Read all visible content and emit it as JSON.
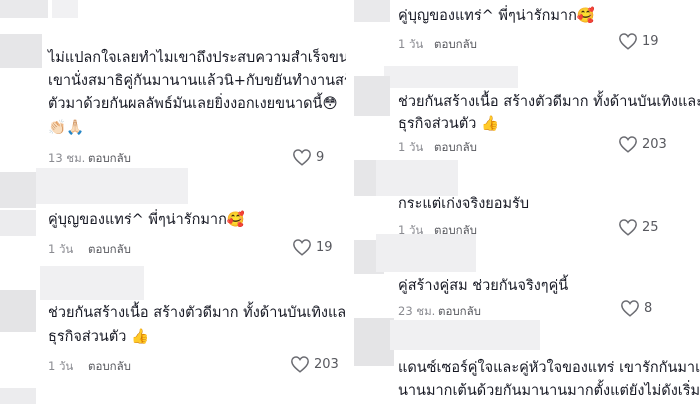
{
  "left": {
    "comments": [
      {
        "lines": [
          "ไม่แปลกใจเลยทำไมเขาถึงประสบความสำเร็จขนาดนี้",
          "เขานั่งสมาธิคู่กันมานานแล้วนิ+กับขยันทำงานสร้าง",
          "ตัวมาด้วยกันผลลัพธ์มันเลยยิ่งงอกเงยขนาดนี้😳",
          "👏🏻🙏🏻"
        ],
        "time": "13 ชม.",
        "reply": "ตอบกลับ",
        "likes": "9"
      },
      {
        "lines": [
          "คู่บุญของแทร่^ พี่ๆน่ารักมาก🥰"
        ],
        "time": "1 วัน",
        "reply": "ตอบกลับ",
        "likes": "19"
      },
      {
        "lines": [
          "ช่วยกันสร้างเนื้อ สร้างตัวดีมาก ทั้งด้านบันเทิงและ",
          "ธุรกิจส่วนตัว 👍"
        ],
        "time": "1 วัน",
        "reply": "ตอบกลับ",
        "likes": "203"
      }
    ]
  },
  "right": {
    "comments": [
      {
        "lines": [
          "คู่บุญของแทร่^ พี่ๆน่ารักมาก🥰"
        ],
        "time": "1 วัน",
        "reply": "ตอบกลับ",
        "likes": "19"
      },
      {
        "lines": [
          "ช่วยกันสร้างเนื้อ สร้างตัวดีมาก ทั้งด้านบันเทิงและ",
          "ธุรกิจส่วนตัว 👍"
        ],
        "time": "1 วัน",
        "reply": "ตอบกลับ",
        "likes": "203"
      },
      {
        "lines": [
          "กระแต่เก่งจริงยอมรับ"
        ],
        "time": "1 วัน",
        "reply": "ตอบกลับ",
        "likes": "25"
      },
      {
        "lines": [
          "คู่สร้างคู่สม ช่วยกันจริงๆคู่นี้"
        ],
        "time": "23 ชม.",
        "reply": "ตอบกลับ",
        "likes": "8"
      },
      {
        "lines": [
          "แดนซ์เซอร์คู่ใจและคู่หัวใจของแทร่ เขารักกันมาแบบ",
          "นานมากเต้นด้วยกันมานานมากตั้งแต่ยังไม่ดังเริ่มต้น"
        ],
        "time": "",
        "reply": "",
        "likes": ""
      }
    ]
  },
  "icons": {
    "like": "heart-outline-icon"
  },
  "colors": {
    "text": "#161823",
    "meta": "#8a8b91",
    "placeholder": "#e6e6e8"
  }
}
